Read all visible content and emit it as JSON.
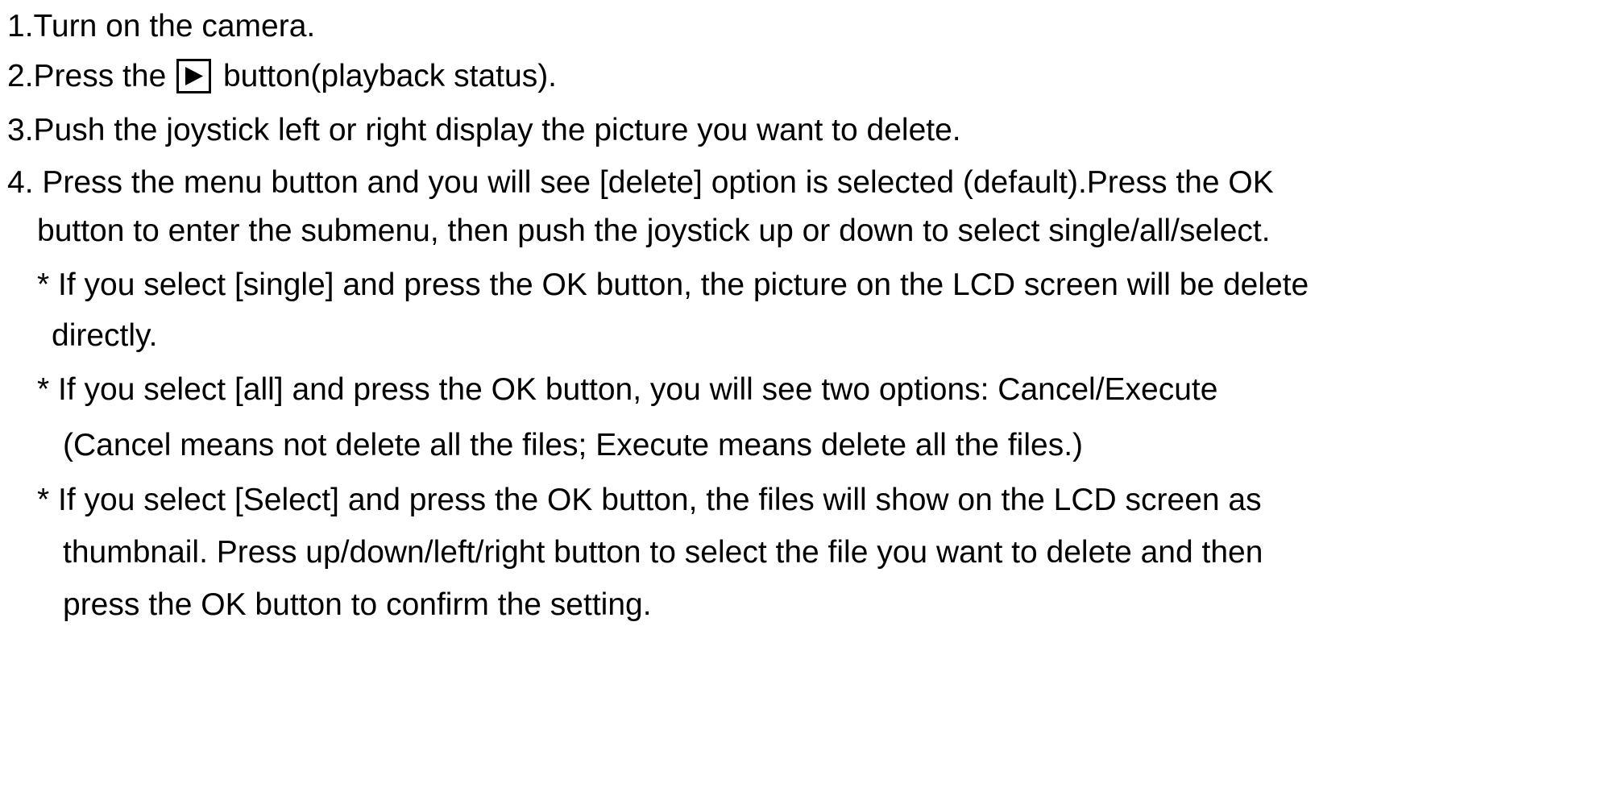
{
  "steps": {
    "step1": "1.Turn on the camera.",
    "step2_before": "2.Press the",
    "step2_icon": "play-icon",
    "step2_after": " button(playback status).",
    "step3": "3.Push the joystick left or right display the picture you want to delete.",
    "step4_line1": "4. Press the menu button and you will see [delete] option is selected (default).Press the OK",
    "step4_line2": "button to enter the submenu, then push the joystick up or down to select single/all/select.",
    "single_line1": "* If you select [single] and press the OK button, the picture on the LCD screen will be delete",
    "single_line2": "directly.",
    "all_line1": "* If you select [all] and press the OK button, you will see two options: Cancel/Execute",
    "all_line2": "(Cancel means not delete all the files; Execute means delete all the files.)",
    "select_line1": "* If you select [Select] and press the OK button, the files will show on the LCD screen as",
    "select_line2": "thumbnail. Press up/down/left/right button to select the file you want to delete and then",
    "select_line3": "press the OK button to confirm the setting."
  }
}
